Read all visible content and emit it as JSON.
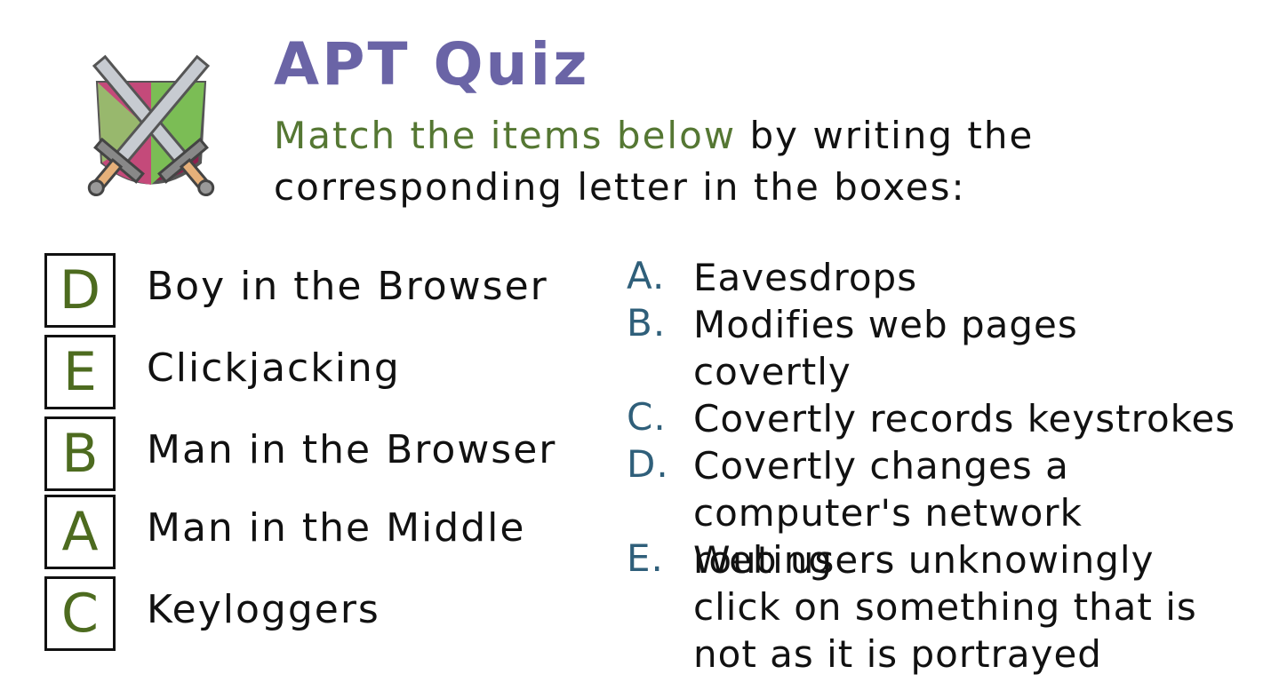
{
  "title": "APT Quiz",
  "instruction": {
    "highlight": "Match the items below",
    "line1_rest": " by writing the",
    "line2": "corresponding letter in the boxes:"
  },
  "items": [
    {
      "answer": "D",
      "label": "Boy in the Browser"
    },
    {
      "answer": "E",
      "label": "Clickjacking"
    },
    {
      "answer": "B",
      "label": "Man in the Browser"
    },
    {
      "answer": "A",
      "label": "Man in the Middle"
    },
    {
      "answer": "C",
      "label": "Keyloggers"
    }
  ],
  "definitions": [
    {
      "letter": "A.",
      "text": "Eavesdrops"
    },
    {
      "letter": "B.",
      "text": "Modifies web pages covertly"
    },
    {
      "letter": "C.",
      "text": "Covertly records keystrokes"
    },
    {
      "letter": "D.",
      "text": "Covertly changes a computer's network routing"
    },
    {
      "letter": "E.",
      "text": "Web users unknowingly click on something that is not as it is portrayed"
    }
  ],
  "colors": {
    "title": "#6a64a6",
    "highlight": "#557733",
    "answer": "#4d6b1f",
    "letter": "#2f5f7a"
  },
  "icons": [
    "crossed-swords-shield-icon"
  ]
}
